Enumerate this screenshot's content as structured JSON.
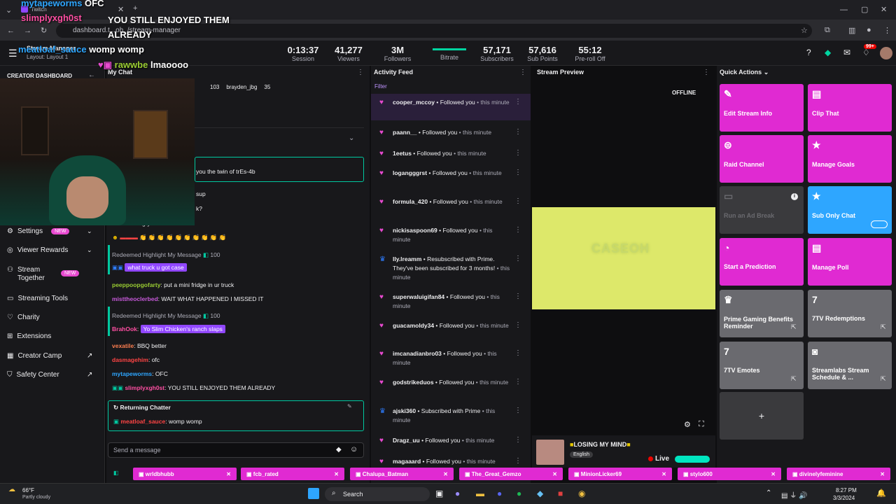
{
  "browser": {
    "tab_title": "Twitch",
    "url": "dashboard.t...oh_/stream-manager"
  },
  "overlay_chat": [
    {
      "user": "mytapeworms",
      "msg": "OFC",
      "color": "#2ea6ff"
    },
    {
      "user": "slimplyxgh0st",
      "msg": "YOU STILL ENJOYED THEM ALREADY",
      "color": "#ff4fa3"
    },
    {
      "user": "meatloaf_sauce",
      "msg": "womp womp",
      "color": "#2ea6ff"
    },
    {
      "user": "rawwbe",
      "msg": "lmaoooo",
      "color": "#9acd32"
    }
  ],
  "topbar": {
    "layout_title": "Stream Manager",
    "layout_sub": "Layout: Layout 1",
    "stats": [
      {
        "value": "0:13:37",
        "label": "Session"
      },
      {
        "value": "41,277",
        "label": "Viewers"
      },
      {
        "value": "3M",
        "label": "Followers"
      },
      {
        "value": "",
        "label": "Bitrate"
      },
      {
        "value": "57,171",
        "label": "Subscribers"
      },
      {
        "value": "57,616",
        "label": "Sub Points"
      },
      {
        "value": "55:12",
        "label": "Pre-roll Off"
      }
    ],
    "notif_count": "99+"
  },
  "sidebar": {
    "header": "CREATOR DASHBOARD",
    "items": [
      {
        "label": "Settings",
        "badge": "NEW"
      },
      {
        "label": "Viewer Rewards",
        "badge": ""
      },
      {
        "label": "Stream Together",
        "badge": "NEW"
      },
      {
        "label": "Streaming Tools",
        "badge": ""
      },
      {
        "label": "Charity",
        "badge": ""
      },
      {
        "label": "Extensions",
        "badge": ""
      },
      {
        "label": "Creator Camp",
        "badge": ""
      },
      {
        "label": "Safety Center",
        "badge": ""
      }
    ]
  },
  "chat": {
    "title": "My Chat",
    "top_chatters": [
      {
        "name": "",
        "count": "103"
      },
      {
        "name": "brayden_jbg",
        "count": ""
      },
      {
        "name": "",
        "count": "35"
      }
    ],
    "pinned_snippet": "you the twin of trEs-4b",
    "snippet2": "sup",
    "snippet3": "k?",
    "lines": [
      {
        "user": "",
        "msg": "case is hungry",
        "color": "#9147ff",
        "type": "plain"
      },
      {
        "user": "",
        "msg": "",
        "color": "#ff4444",
        "type": "emotes"
      },
      {
        "user": "",
        "msg": "Redeemed Highlight My Message",
        "points": "100",
        "type": "redeem"
      },
      {
        "user": "",
        "msg": "what truck u got case",
        "color": "#2e7dff",
        "type": "highlight"
      },
      {
        "user": "peeppoopgofarty",
        "msg": "put a mini fridge in ur truck",
        "color": "#9acd32",
        "type": "plain"
      },
      {
        "user": "misttheoclerbed",
        "msg": "WAIT WHAT HAPPENED I MISSED IT",
        "color": "#c85adb",
        "type": "plain"
      },
      {
        "user": "",
        "msg": "Redeemed Highlight My Message",
        "points": "100",
        "type": "redeem"
      },
      {
        "user": "BrahOok",
        "msg": "Yo Slim Chicken's ranch slaps",
        "color": "#ff4fa3",
        "type": "highlight"
      },
      {
        "user": "vexatile",
        "msg": "BBQ better",
        "color": "#ff7f50",
        "type": "plain"
      },
      {
        "user": "dasmagehim",
        "msg": "ofc",
        "color": "#ff4444",
        "type": "plain"
      },
      {
        "user": "mytapeworms",
        "msg": "OFC",
        "color": "#2ea6ff",
        "type": "plain"
      },
      {
        "user": "slimplyxgh0st",
        "msg": "YOU STILL ENJOYED THEM ALREADY",
        "color": "#ff4fa3",
        "type": "plain"
      }
    ],
    "returning_title": "Returning Chatter",
    "returning_user": "meatloaf_sauce",
    "returning_msg": "womp womp",
    "input_placeholder": "Send a message"
  },
  "activity": {
    "title": "Activity Feed",
    "filter": "Filter",
    "items": [
      {
        "user": "cooper_mccoy",
        "action": "Followed you",
        "time": "this minute",
        "icon": "heart"
      },
      {
        "user": "paann__",
        "action": "Followed you",
        "time": "this minute",
        "icon": "heart"
      },
      {
        "user": "1eetus",
        "action": "Followed you",
        "time": "this minute",
        "icon": "heart"
      },
      {
        "user": "logangggrst",
        "action": "Followed you",
        "time": "this minute",
        "icon": "heart"
      },
      {
        "user": "formula_420",
        "action": "Followed you",
        "time": "this minute",
        "icon": "heart"
      },
      {
        "user": "nickisaspoon69",
        "action": "Followed you",
        "time": "this minute",
        "icon": "heart"
      },
      {
        "user": "lly.lreamm",
        "action": "Resubscribed with Prime. They've been subscribed for 3 months!",
        "time": "this minute",
        "icon": "crown"
      },
      {
        "user": "superwaluigifan84",
        "action": "Followed you",
        "time": "this minute",
        "icon": "heart"
      },
      {
        "user": "guacamoldy34",
        "action": "Followed you",
        "time": "this minute",
        "icon": "heart"
      },
      {
        "user": "imcanadianbro03",
        "action": "Followed you",
        "time": "this minute",
        "icon": "heart"
      },
      {
        "user": "godstrikeduos",
        "action": "Followed you",
        "time": "this minute",
        "icon": "heart"
      },
      {
        "user": "ajski360",
        "action": "Subscribed with Prime",
        "time": "this minute",
        "icon": "crown"
      },
      {
        "user": "Dragz_uu",
        "action": "Followed you",
        "time": "this minute",
        "icon": "heart"
      },
      {
        "user": "magaaard",
        "action": "Followed you",
        "time": "this minute",
        "icon": "heart"
      }
    ]
  },
  "preview": {
    "title": "Stream Preview",
    "status": "OFFLINE",
    "overlay_text": "CASEOH",
    "stream_title": "LOSING MY MIND",
    "language": "English",
    "live": "Live"
  },
  "quick_actions": {
    "title": "Quick Actions",
    "tiles": [
      {
        "label": "Edit Stream Info",
        "color": "#e02ad2",
        "icon": "pencil"
      },
      {
        "label": "Clip That",
        "color": "#e02ad2",
        "icon": "clip"
      },
      {
        "label": "Raid Channel",
        "color": "#e02ad2",
        "icon": "raid"
      },
      {
        "label": "Manage Goals",
        "color": "#e02ad2",
        "icon": "star"
      },
      {
        "label": "Run an Ad Break",
        "color": "#3a3a3d",
        "icon": "ad"
      },
      {
        "label": "Sub Only Chat",
        "color": "#2ea6ff",
        "icon": "star"
      },
      {
        "label": "Start a Prediction",
        "color": "#e02ad2",
        "icon": "prediction"
      },
      {
        "label": "Manage Poll",
        "color": "#e02ad2",
        "icon": "poll"
      },
      {
        "label": "Prime Gaming Benefits Reminder",
        "color": "#6a6a6f",
        "icon": "prime"
      },
      {
        "label": "7TV Redemptions",
        "color": "#6a6a6f",
        "icon": "7tv"
      },
      {
        "label": "7TV Emotes",
        "color": "#6a6a6f",
        "icon": "7tv"
      },
      {
        "label": "Streamlabs Stream Schedule & ...",
        "color": "#6a6a6f",
        "icon": "streamlabs"
      }
    ],
    "add_label": "+"
  },
  "bottom_tabs": [
    "wrldbhubb",
    "fcb_rated",
    "Chalupa_Batman",
    "The_Great_Gemzo",
    "MinionLicker69",
    "stylo600",
    "divinelyfeminine"
  ],
  "taskbar": {
    "weather_temp": "66°F",
    "weather_desc": "Partly cloudy",
    "search": "Search",
    "time": "8:27 PM",
    "date": "3/3/2024"
  }
}
